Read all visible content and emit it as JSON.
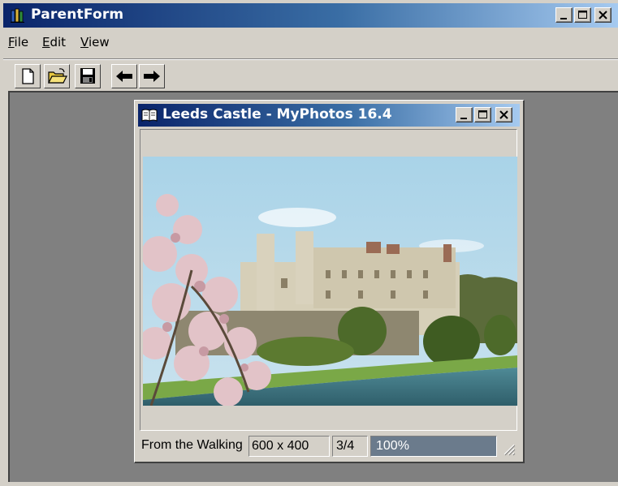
{
  "window": {
    "title": "ParentForm",
    "controls": [
      "minimize",
      "maximize",
      "close"
    ]
  },
  "menubar": {
    "items": [
      {
        "label": "File",
        "mnemonic": "F",
        "rest": "ile"
      },
      {
        "label": "Edit",
        "mnemonic": "E",
        "rest": "dit"
      },
      {
        "label": "View",
        "mnemonic": "V",
        "rest": "iew"
      }
    ]
  },
  "toolbar": {
    "buttons": [
      "new-document-icon",
      "open-folder-icon",
      "save-disk-icon",
      "arrow-left-icon",
      "arrow-right-icon"
    ]
  },
  "child_window": {
    "title": "Leeds Castle - MyPhotos 16.4",
    "image_alt": "Photo of Leeds Castle with moat and flowering tree"
  },
  "statusbar": {
    "caption": "From the Walking",
    "dimensions": "600 x 400",
    "position": "3/4",
    "zoom": "100%",
    "zoom_fill": 1.0
  },
  "colors": {
    "titlebar_start": "#0a246a",
    "titlebar_end": "#a6caf0",
    "mdi_background": "#808080",
    "face": "#d4d0c8"
  }
}
